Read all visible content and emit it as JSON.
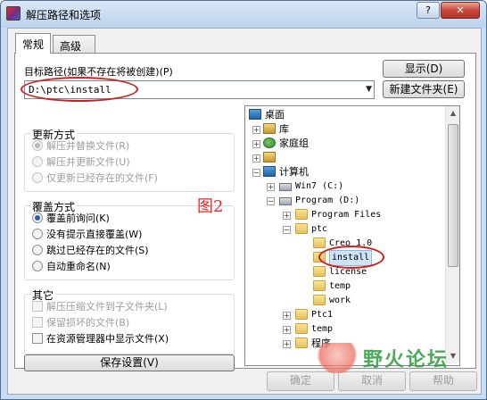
{
  "window": {
    "title": "解压路径和选项",
    "help_label": "?",
    "close_label": "✕"
  },
  "tabs": [
    {
      "label": "常规",
      "active": true
    },
    {
      "label": "高级",
      "active": false
    }
  ],
  "target": {
    "label": "目标路径(如果不存在将被创建)(P)",
    "value": "D:\\ptc\\install",
    "show_button": "显示(D)",
    "new_folder_button": "新建文件夹(E)"
  },
  "update_mode": {
    "title": "更新方式",
    "options": [
      {
        "label": "解压并替换文件(R)",
        "selected": true,
        "enabled": false
      },
      {
        "label": "解压并更新文件(U)",
        "selected": false,
        "enabled": false
      },
      {
        "label": "仅更新已经存在的文件(F)",
        "selected": false,
        "enabled": false
      }
    ]
  },
  "overwrite_mode": {
    "title": "覆盖方式",
    "options": [
      {
        "label": "覆盖前询问(K)",
        "selected": true
      },
      {
        "label": "没有提示直接覆盖(W)",
        "selected": false
      },
      {
        "label": "跳过已经存在的文件(S)",
        "selected": false
      },
      {
        "label": "自动重命名(N)",
        "selected": false
      }
    ]
  },
  "misc": {
    "title": "其它",
    "options": [
      {
        "label": "解压压缩文件到子文件夹(L)",
        "checked": false,
        "enabled": false
      },
      {
        "label": "保留损坏的文件(B)",
        "checked": false,
        "enabled": false
      },
      {
        "label": "在资源管理器中显示文件(X)",
        "checked": false,
        "enabled": true
      }
    ]
  },
  "save_button": "保存设置(V)",
  "annotation": "图2",
  "tree": [
    {
      "label": "桌面",
      "icon": "monitor-icon",
      "expander": ""
    },
    {
      "label": "库",
      "icon": "library-icon",
      "expander": "+"
    },
    {
      "label": "家庭组",
      "icon": "homegroup-icon",
      "expander": "+"
    },
    {
      "label": "",
      "icon": "user-folder-icon",
      "expander": "+"
    },
    {
      "label": "计算机",
      "icon": "computer-icon",
      "expander": "-"
    },
    {
      "label": "Win7 (C:)",
      "icon": "drive-icon",
      "expander": "+"
    },
    {
      "label": "Program (D:)",
      "icon": "drive-icon",
      "expander": "-"
    },
    {
      "label": "Program Files",
      "icon": "folder-icon",
      "expander": "+"
    },
    {
      "label": "ptc",
      "icon": "folder-icon",
      "expander": "-"
    },
    {
      "label": "Creo 1.0",
      "icon": "folder-icon",
      "expander": ""
    },
    {
      "label": "install",
      "icon": "folder-icon",
      "expander": "",
      "selected": true
    },
    {
      "label": "license",
      "icon": "folder-icon",
      "expander": ""
    },
    {
      "label": "temp",
      "icon": "folder-icon",
      "expander": ""
    },
    {
      "label": "work",
      "icon": "folder-icon",
      "expander": ""
    },
    {
      "label": "Ptc1",
      "icon": "folder-icon",
      "expander": "+"
    },
    {
      "label": "temp",
      "icon": "folder-icon",
      "expander": "+"
    },
    {
      "label": "程序",
      "icon": "folder-icon",
      "expander": "+"
    }
  ],
  "footer": {
    "ok": "确定",
    "cancel": "取消",
    "help": "帮助"
  },
  "watermark": "野火论坛"
}
